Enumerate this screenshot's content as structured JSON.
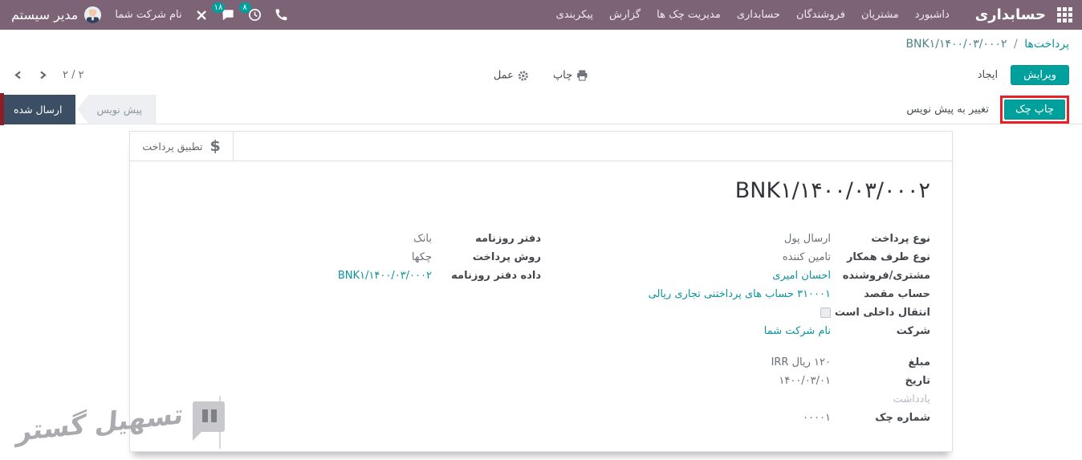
{
  "navbar": {
    "app_title": "حسابداری",
    "menu_items": [
      "داشبورد",
      "مشتریان",
      "فروشندگان",
      "حسابداری",
      "مدیریت چک ها",
      "گزارش",
      "پیکربندی"
    ],
    "systray": {
      "company": "نام شرکت شما",
      "user": "مدیر سیستم",
      "messages_badge": "۱۸",
      "activities_badge": "۸"
    }
  },
  "control_panel": {
    "breadcrumb": {
      "parent": "پرداخت‌ها",
      "separator": "/",
      "current": "BNK۱/۱۴۰۰/۰۳/۰۰۰۲"
    },
    "edit_button": "ویرایش",
    "create_button": "ایجاد",
    "print_menu": "چاپ",
    "action_menu": "عمل",
    "pager_count": "۲ / ۲"
  },
  "action_bar": {
    "print_check_button": "چاپ چک",
    "reset_draft_button": "تغییر به پیش نویس",
    "statusbar": {
      "draft": "پیش نویس",
      "sent": "ارسال شده",
      "active": "ارسال شده"
    }
  },
  "sheet": {
    "payment_matching_button": {
      "icon": "$",
      "label": "تطبیق پرداخت"
    },
    "title": "BNK۱/۱۴۰۰/۰۳/۰۰۰۲",
    "fields": {
      "payment_type": {
        "label": "نوع پرداخت",
        "value": "ارسال پول"
      },
      "partner_type": {
        "label": "نوع طرف همکار",
        "value": "تامین کننده"
      },
      "partner": {
        "label": "مشتری/فروشنده",
        "value": "احسان امیری"
      },
      "destination_account": {
        "label": "حساب مقصد",
        "value": "۳۱۰۰۰۱ حساب های پرداختنی تجاری ریالی"
      },
      "internal_transfer": {
        "label": "انتقال داخلی است",
        "checked": false
      },
      "company": {
        "label": "شرکت",
        "value": "نام شرکت شما"
      },
      "journal": {
        "label": "دفتر روزنامه",
        "value": "بانک"
      },
      "payment_method": {
        "label": "روش پرداخت",
        "value": "چکها"
      },
      "journal_entry": {
        "label": "داده دفتر روزنامه",
        "value": "BNK۱/۱۴۰۰/۰۳/۰۰۰۲"
      },
      "amount": {
        "label": "مبلغ",
        "value": "۱۲۰ ریال IRR"
      },
      "date": {
        "label": "تاریخ",
        "value": "۱۴۰۰/۰۳/۰۱"
      },
      "memo": {
        "label": "یادداشت",
        "value": ""
      },
      "check_number": {
        "label": "شماره چک",
        "value": "۰۰۰۰۱"
      }
    }
  },
  "watermark": {
    "text": "تسهیل گستر"
  },
  "colors": {
    "navbar": "#7d6376",
    "accent_teal": "#00a09d",
    "link_teal": "#0c949b",
    "status_active": "#3c4e63",
    "annotation_red": "#e82127"
  }
}
